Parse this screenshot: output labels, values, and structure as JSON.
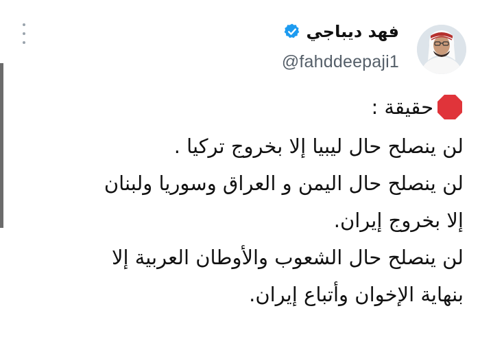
{
  "user": {
    "display_name": "فهد ديباجي",
    "handle": "@fahddeepaji1",
    "verified_icon": "verified-badge-icon",
    "avatar_icon": "profile-photo"
  },
  "menu_icon": "more-options-icon",
  "tweet": {
    "heading_icon": "stop-sign-icon",
    "heading": "حقيقة :",
    "lines": [
      "لن ينصلح حال ليبيا إلا بخروج تركيا .",
      "لن ينصلح حال اليمن و العراق وسوريا ولبنان",
      "إلا بخروج إيران.",
      "لن ينصلح حال الشعوب والأوطان العربية إلا",
      "بنهاية الإخوان وأتباع إيران."
    ]
  },
  "colors": {
    "verified": "#1d9bf0",
    "stop_sign": "#e0343a",
    "handle_text": "#555f69",
    "body_text": "#111111"
  }
}
